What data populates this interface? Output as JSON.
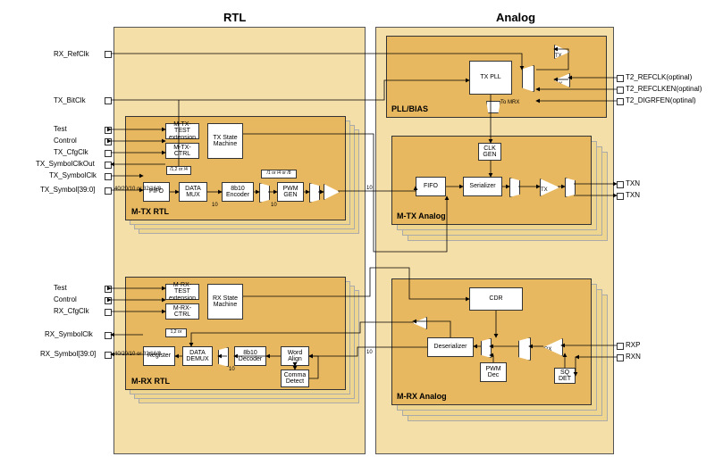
{
  "titles": {
    "rtl": "RTL",
    "analog": "Analog"
  },
  "ports_left_tx": {
    "rx_refclk": "RX_RefClk",
    "tx_bitclk": "TX_BitClk",
    "test": "Test",
    "control": "Control",
    "tx_cfgclk": "TX_CfgClk",
    "tx_symbolclkout": "TX_SymbolClkOut",
    "tx_symbolclk": "TX_SymbolClk",
    "tx_symbol": "TX_Symbol[39:0]"
  },
  "ports_left_rx": {
    "test": "Test",
    "control": "Control",
    "rx_cfgclk": "RX_CfgClk",
    "rx_symbolclk": "RX_SymbolClk",
    "rx_symbol": "RX_Symbol[39:0]"
  },
  "ports_right": {
    "t2_refclk": "T2_REFCLK(optinal)",
    "t2_refclken": "T2_REFCLKEN(optinal)",
    "t2_digrfen": "T2_DIGRFEN(optinal)",
    "txn1": "TXN",
    "txn2": "TXN",
    "rxp": "RXP",
    "rxn": "RXN"
  },
  "modules": {
    "mtx_rtl": "M-TX RTL",
    "mrx_rtl": "M-RX RTL",
    "pll_bias": "PLL/BIAS",
    "mtx_analog": "M-TX Analog",
    "mrx_analog": "M-RX Analog"
  },
  "blocks": {
    "mtx_test": "M-TX-TEST\nextension",
    "mtx_ctrl": "M-TX-\nCTRL",
    "tx_state": "TX State\nMachine",
    "fifo": "FIFO",
    "data_mux": "DATA\nMUX",
    "enc8b10": "8b10\nEncoder",
    "pwm_gen": "PWM\nGEN",
    "mrx_test": "M-RX-TEST\nextension",
    "mrx_ctrl": "M-RX-\nCTRL",
    "rx_state": "RX State\nMachine",
    "register": "Register",
    "data_demux": "DATA\nDEMUX",
    "dec8b10": "8b10\nDecoder",
    "word_align": "Word\nAlign",
    "comma_det": "Comma\nDetect",
    "tx_pll": "TX PLL",
    "clk_gen": "CLK\nGEN",
    "fifo2": "FIFO",
    "serializer": "Serializer",
    "cdr": "CDR",
    "deserializer": "Deserializer",
    "pwm_dec": "PWM\nDec",
    "sq_det": "SQ\nDET",
    "tx_amp": "TX",
    "rx_amp": "RX"
  },
  "annot": {
    "bus_40_20_10": "40/20/10\nor 32/16/8",
    "w10": "10",
    "div12": "/1,2 or /4",
    "div1_4_8": "/1 or /4 or /8",
    "mux12": "1,2 or",
    "to_mrx": "To\nMRX"
  }
}
